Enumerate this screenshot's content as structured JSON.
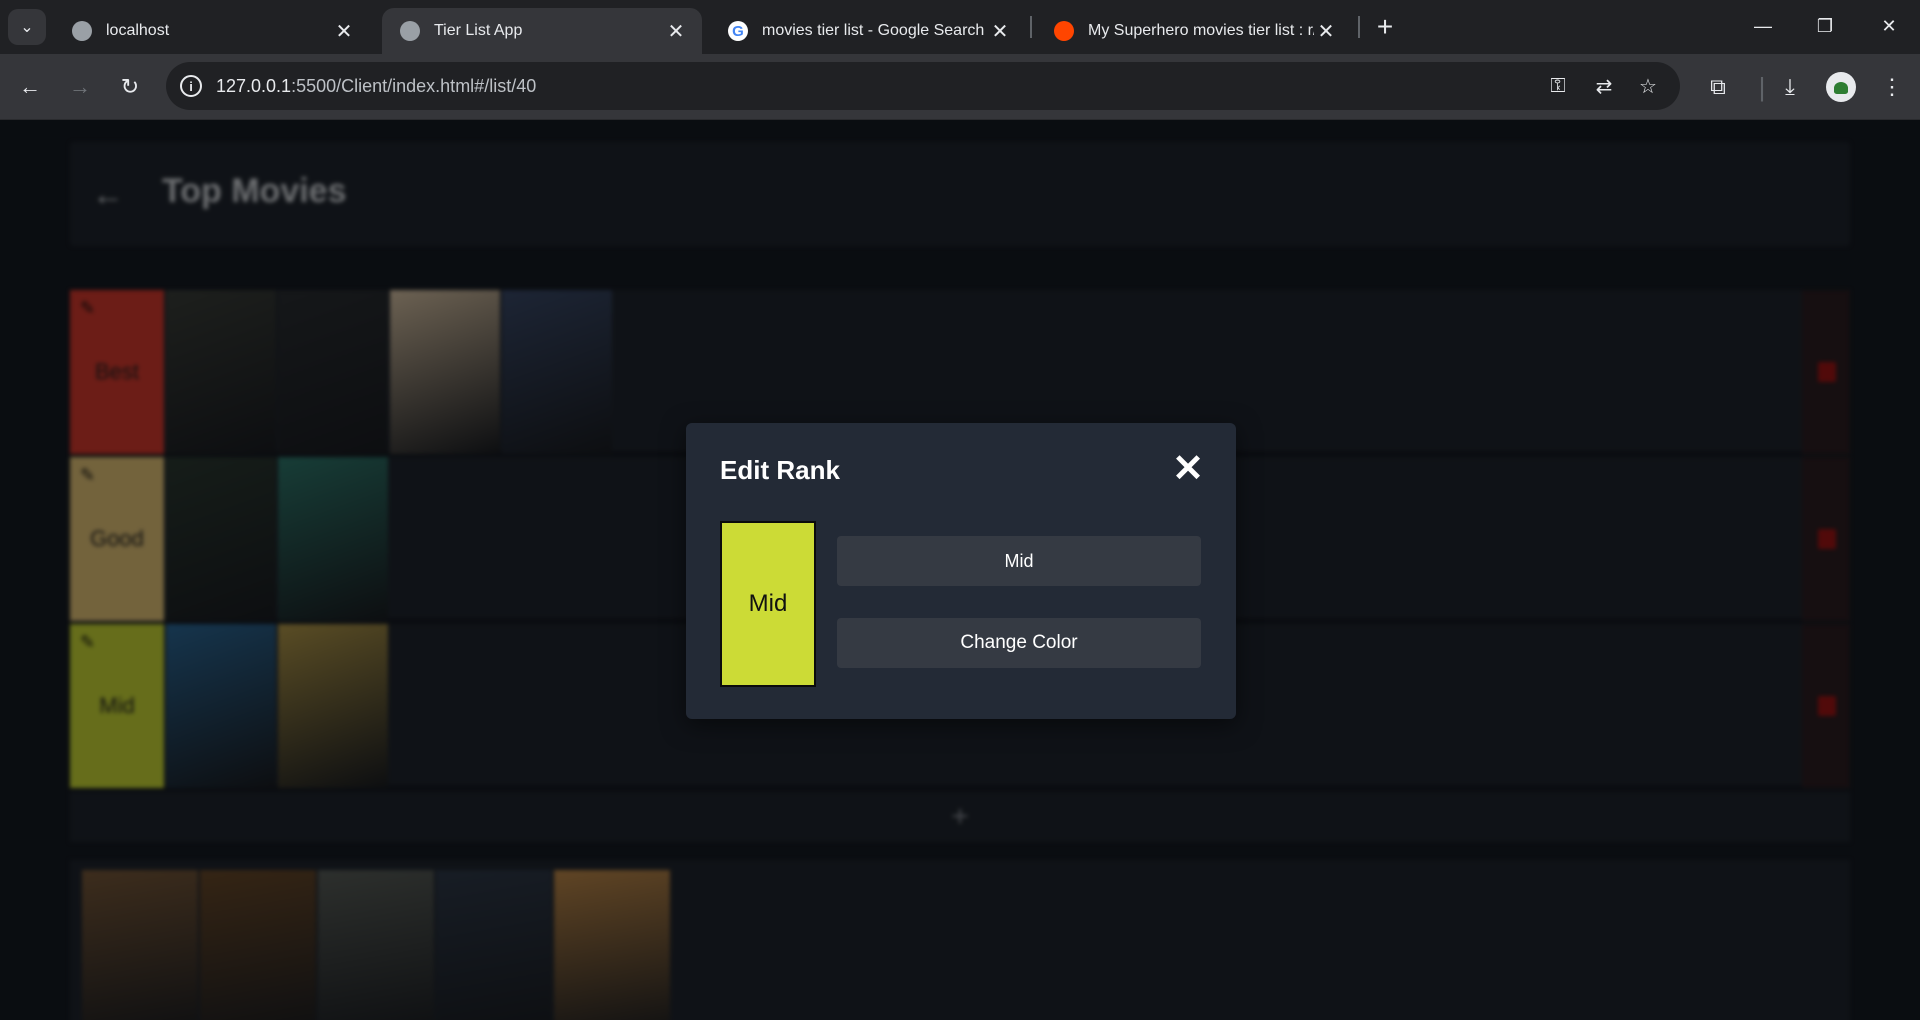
{
  "browser": {
    "tabs": [
      {
        "title": "localhost"
      },
      {
        "title": "Tier List App"
      },
      {
        "title": "movies tier list - Google Search"
      },
      {
        "title": "My Superhero movies tier list : r/m"
      }
    ],
    "url_host": "127.0.0.1",
    "url_rest": ":5500/Client/index.html#/list/40"
  },
  "page": {
    "title": "Top Movies",
    "tiers": [
      {
        "label": "Best",
        "color": "#d83a2e",
        "posters": [
          "#3b3f3a",
          "#2b2f33",
          "#d9c4a6",
          "#3a4a6a"
        ]
      },
      {
        "label": "Good",
        "color": "#e6c679",
        "posters": [
          "#2c3a32",
          "#2f7a6e"
        ]
      },
      {
        "label": "Mid",
        "color": "#ccdb36",
        "posters": [
          "#2c6a9a",
          "#b49a4a"
        ]
      }
    ],
    "add_tier_symbol": "+",
    "pool_posters": [
      "#7a5a3a",
      "#6a4a2a",
      "#5a5f5a",
      "#2f3a4a",
      "#c08a4a"
    ]
  },
  "modal": {
    "title": "Edit Rank",
    "close_symbol": "✕",
    "preview_label": "Mid",
    "preview_color": "#ccdb36",
    "name_value": "Mid",
    "change_color_label": "Change Color"
  }
}
